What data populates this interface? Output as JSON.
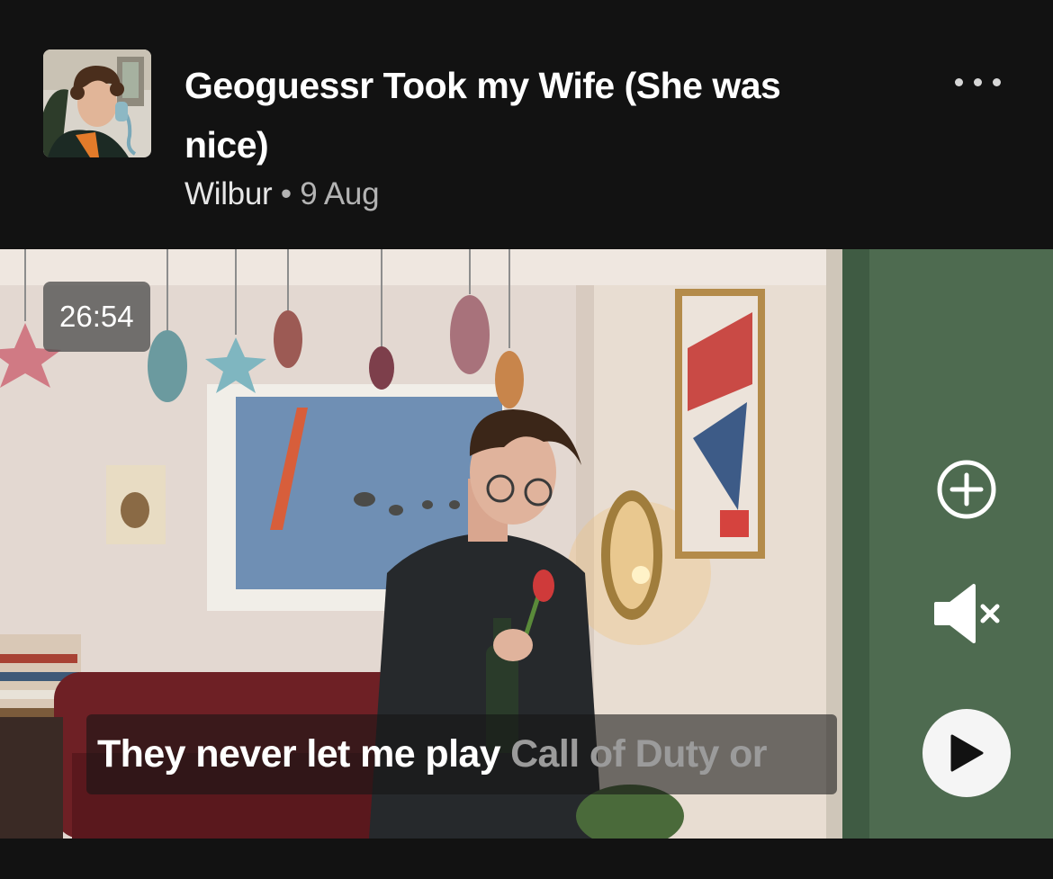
{
  "episode": {
    "title": "Geoguessr Took my Wife (She was nice)",
    "author": "Wilbur",
    "separator": "•",
    "date": "9 Aug",
    "cover_alt": "podcast-cover-art"
  },
  "video": {
    "duration": "26:54",
    "caption_spoken": "They never let me play",
    "caption_upcoming": "Call of Duty or"
  },
  "controls": {
    "more_icon": "more-horizontal-icon",
    "add_icon": "plus-circle-icon",
    "mute_icon": "volume-muted-icon",
    "play_icon": "play-icon"
  },
  "colors": {
    "background": "#121212",
    "title": "#ffffff",
    "meta": "#b3b3b3"
  }
}
